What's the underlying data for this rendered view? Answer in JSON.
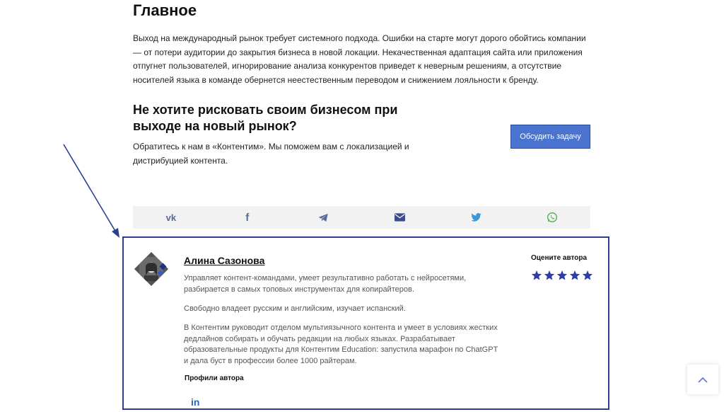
{
  "article": {
    "heading": "Главное",
    "intro": "Выход на международный рынок требует системного подхода. Ошибки на старте могут дорого обойтись компании — от потери аудитории до закрытия бизнеса в новой локации. Некачественная адаптация сайта или приложения отпугнет пользователей, игнорирование анализа конкурентов приведет к неверным решениям, а отсутствие носителей языка в команде обернется неестественным переводом и снижением лояльности к бренду."
  },
  "cta": {
    "title": "Не хотите рисковать своим бизнесом при выходе на новый рынок?",
    "text": "Обратитесь к нам в «Контентим». Мы поможем вам с локализацией и дистрибуцией контента.",
    "button_label": "Обсудить задачу"
  },
  "share": {
    "items": [
      {
        "name": "vk-icon",
        "glyph": "vk"
      },
      {
        "name": "facebook-icon",
        "glyph": "f"
      },
      {
        "name": "telegram-icon",
        "glyph": ""
      },
      {
        "name": "email-icon",
        "glyph": ""
      },
      {
        "name": "twitter-icon",
        "glyph": ""
      },
      {
        "name": "whatsapp-icon",
        "glyph": ""
      }
    ],
    "icon_color": "#5a6a9c",
    "whatsapp_color": "#4caf50",
    "twitter_color": "#3a9ad9"
  },
  "author": {
    "name": "Алина Сазонова",
    "bio_1": "Управляет контент-командами, умеет результативно работать с нейросетями, разбирается в самых топовых инструментах для копирайтеров.",
    "bio_2": "Свободно владеет русским и английским, изучает испанский.",
    "bio_3": "В Контентим руководит отделом мультиязычного контента и умеет в условиях жестких дедлайнов собирать и обучать редакции на любых языках. Разрабатывает образовательные продукты для Контентим Education: запустила марафон по ChatGPT и дала буст в профессии более 1000 райтерам.",
    "profiles_label": "Профили автора",
    "linkedin_glyph": "in"
  },
  "rating": {
    "label": "Оцените автора",
    "stars": 5,
    "star_color": "#2d3ea8"
  },
  "colors": {
    "accent": "#4a74cf",
    "border": "#2a3f8f"
  }
}
